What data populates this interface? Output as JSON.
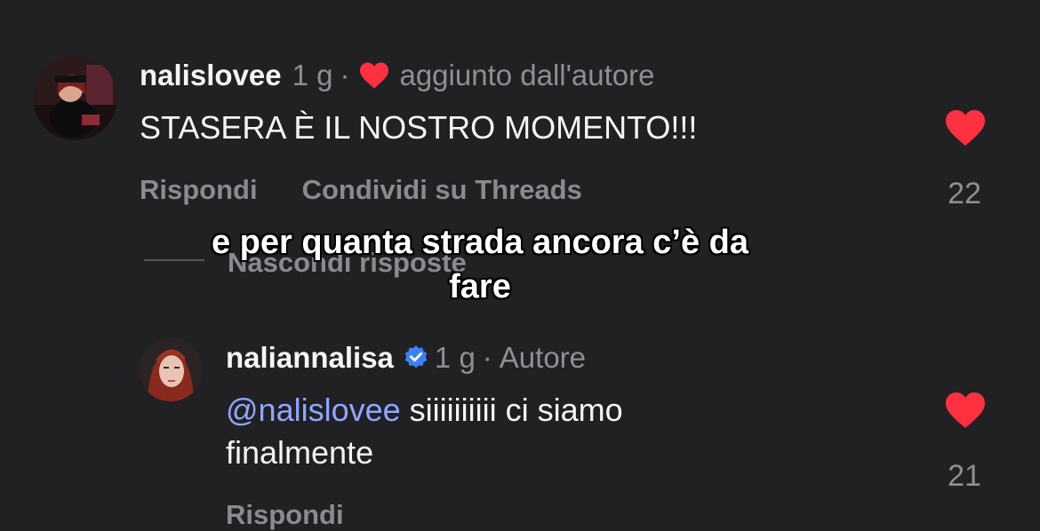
{
  "comments": [
    {
      "username": "nalislovee",
      "time": "1 g",
      "separator": "·",
      "liked_by_author_text": "aggiunto dall'autore",
      "text": "STASERA È IL NOSTRO MOMENTO!!!",
      "reply_label": "Rispondi",
      "share_label": "Condividi su Threads",
      "like_count": "22"
    }
  ],
  "hide_replies_label": "Nascondi risposte",
  "reply": {
    "username": "naliannalisa",
    "time": "1 g",
    "separator": "·",
    "author_badge": "Autore",
    "mention": "@nalislovee",
    "text": " siiiiiiiiii ci siamo",
    "text_line2": "finalmente",
    "reply_label": "Rispondi",
    "like_count": "21"
  },
  "caption": {
    "line1": "e per quanta strada ancora c’è da",
    "line2": "fare"
  },
  "colors": {
    "background": "#212124",
    "heart": "#ff3040",
    "verified": "#3b82f6",
    "mention": "#8fa6ff",
    "secondary_text": "#8e8e93"
  },
  "icons": {
    "heart": "heart-icon",
    "verified": "verified-badge-icon"
  }
}
